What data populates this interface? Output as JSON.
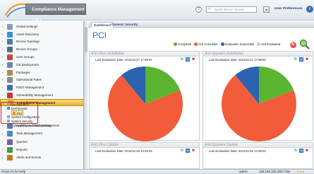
{
  "header": {
    "app_title": "Compliance Management / PCI",
    "help_icon_glyph": "?",
    "search_placeholder": "Quick Device Search",
    "search_dropdown_glyph": "▾",
    "user_prefs": "User Preferences",
    "info_icon_glyph": "i"
  },
  "sidebar": {
    "items": [
      {
        "label": "Global Settings",
        "icon": "globe-icon",
        "color": "#7a9cc7"
      },
      {
        "label": "Asset Discovery",
        "icon": "radar-icon",
        "color": "#3c8fd6"
      },
      {
        "label": "Device Topology",
        "icon": "topology-icon",
        "color": "#4a7bb8"
      },
      {
        "label": "Device Groups",
        "icon": "device-groups-icon",
        "color": "#5a6d80"
      },
      {
        "label": "User Groups",
        "icon": "user-groups-icon",
        "color": "#c24a3a"
      },
      {
        "label": "OS Deployment",
        "icon": "os-deploy-icon",
        "color": "#6b88b3"
      },
      {
        "label": "Packages",
        "icon": "package-icon",
        "color": "#b08a4c"
      },
      {
        "label": "Operational Rules",
        "icon": "gear-icon",
        "color": "#7e8b97"
      },
      {
        "label": "Patch Management",
        "icon": "patch-icon",
        "color": "#3f6fb0"
      },
      {
        "label": "Vulnerability Management",
        "icon": "vulnerability-icon",
        "color": "#c63a3a"
      },
      {
        "label": "Compliance Management",
        "icon": "compliance-icon",
        "color": "#e08a1f"
      }
    ],
    "compliance_children": {
      "configuration": "Configuration",
      "dashboards": "Dashboards",
      "pci": "PCI",
      "system_configuration": "System Configuration",
      "system_security": "System Security",
      "vulnerability_patch": "Vulnerability and Patch Management"
    },
    "bottom_items": [
      {
        "label": "Application Management",
        "icon": "app-mgmt-icon",
        "color": "#5b7aa8"
      },
      {
        "label": "Task Management",
        "icon": "task-icon",
        "color": "#4f86c6"
      },
      {
        "label": "Queries",
        "icon": "query-icon",
        "color": "#7a5ca8"
      },
      {
        "label": "Reports",
        "icon": "reports-icon",
        "color": "#3c9a4a"
      },
      {
        "label": "Alerts and Events",
        "icon": "alerts-icon",
        "color": "#c9781c"
      }
    ],
    "toggle_glyphs": {
      "expand": "+",
      "collapse": "–"
    }
  },
  "tabs": {
    "dashboard": "Dashboard",
    "general": "General",
    "security": "Security"
  },
  "page": {
    "title": "PCI"
  },
  "legend": [
    {
      "label": "Compliant",
      "color": "#5cb531"
    },
    {
      "label": "Not Compliant",
      "color": "#f25c3a"
    },
    {
      "label": "Evaluation Impossible",
      "color": "#2a63b0"
    },
    {
      "label": "Not Evaluated",
      "color": "#c9c9c9"
    }
  ],
  "toolbar": {
    "refresh_glyph": "↻"
  },
  "cards": [
    {
      "title": "Anti-Virus Installation",
      "eval": "Last Evaluation Date: 2011/11/17 17:55:57"
    },
    {
      "title": "Anti-Spyware Installation",
      "eval": "Last Evaluation Date: 2011/11/17 17:58:00"
    },
    {
      "title": "Anti-Virus Update",
      "eval": "Last Evaluation Date: 2011/11/18 14:25:25"
    },
    {
      "title": "Anti-Spyware Update",
      "eval": "Last Evaluation Date: 2011/11/18 14:28:03"
    }
  ],
  "card_tools": {
    "refresh": "↻",
    "export": "▤",
    "remove": "✖"
  },
  "chart_data": [
    {
      "type": "pie",
      "categories": [
        "Compliant",
        "Not Compliant",
        "Evaluation Impossible"
      ],
      "values": [
        19,
        70,
        11
      ],
      "colors": [
        "#5cb531",
        "#f25c3a",
        "#2a63b0"
      ]
    },
    {
      "type": "pie",
      "categories": [
        "Compliant",
        "Not Compliant",
        "Evaluation Impossible"
      ],
      "values": [
        19,
        70,
        11
      ],
      "colors": [
        "#5cb531",
        "#f25c3a",
        "#2a63b0"
      ]
    }
  ],
  "statusbar": {
    "help": "Press F1 for Help",
    "user": "admin",
    "ip": "192.168.100.200:7766",
    "icons": "● ● ●"
  }
}
